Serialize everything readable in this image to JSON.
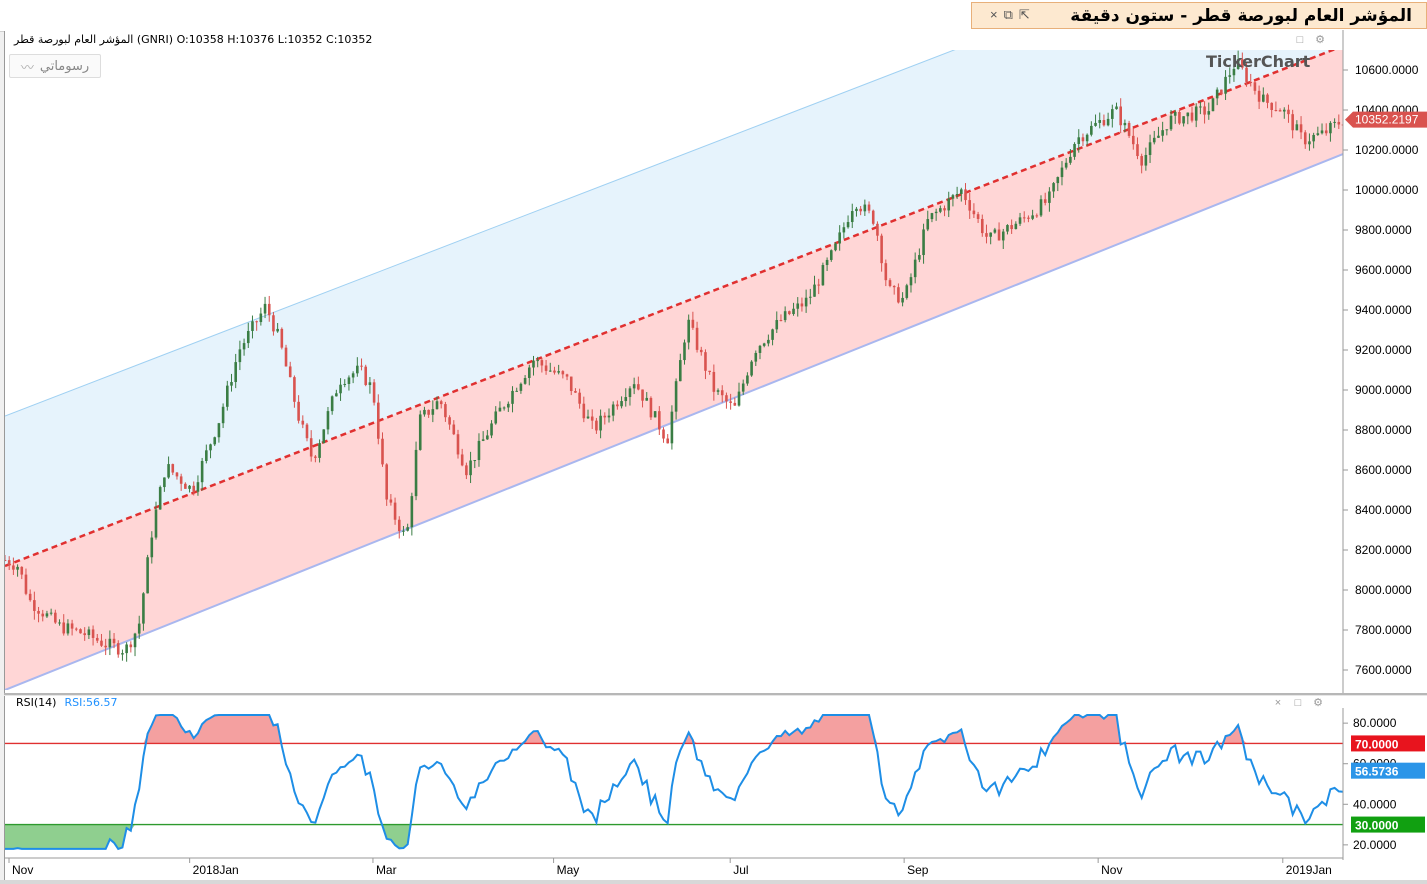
{
  "window": {
    "title": "المؤشر العام لبورصة قطر - ستون دقيقة",
    "close_glyph": "×",
    "restore_glyph": "⧉",
    "popout_glyph": "⇱"
  },
  "info_line": "المؤشر العام لبورصة قطر (GNRI)  O:10358  H:10376  L:10352  C:10352",
  "drawings_button": "رسوماتي",
  "logo": "TickerChart",
  "pane_controls": {
    "close": "×",
    "maximize": "□",
    "settings": "⚙"
  },
  "price_axis": {
    "ticks": [
      "10600.0000",
      "10400.0000",
      "10200.0000",
      "10000.0000",
      "9800.0000",
      "9600.0000",
      "9400.0000",
      "9200.0000",
      "9000.0000",
      "8800.0000",
      "8600.0000",
      "8400.0000",
      "8200.0000",
      "8000.0000",
      "7800.0000",
      "7600.0000"
    ],
    "last_price_label": "10352.2197"
  },
  "time_axis": {
    "labels": [
      "Nov",
      "2018Jan",
      "Mar",
      "May",
      "Jul",
      "Sep",
      "Nov",
      "2019Jan"
    ]
  },
  "rsi": {
    "name": "RSI(14)",
    "value_label": "RSI:56.57",
    "ticks": [
      "80.0000",
      "60.0000",
      "40.0000",
      "20.0000"
    ],
    "overbought_label": "70.0000",
    "oversold_label": "30.0000",
    "current_label": "56.5736"
  },
  "colors": {
    "up": "#3a7d44",
    "down": "#d9534f",
    "channel_upper": "#e6f3fc",
    "channel_lower": "#ffd6d6",
    "midline": "#e03030",
    "rsi_line": "#1e8ee6",
    "rsi_ob": "#e03030",
    "rsi_os": "#2e9a2e",
    "last_price": "#d9534f"
  },
  "chart_data": {
    "type": "candlestick",
    "price_ylim": [
      7500,
      10700
    ],
    "rsi_ylim": [
      15,
      85
    ],
    "rsi_levels": [
      70,
      30
    ],
    "anchors": [
      {
        "t": 0.0,
        "p": 8150
      },
      {
        "t": 0.01,
        "p": 8120
      },
      {
        "t": 0.018,
        "p": 7950
      },
      {
        "t": 0.04,
        "p": 7820
      },
      {
        "t": 0.06,
        "p": 7780
      },
      {
        "t": 0.075,
        "p": 7730
      },
      {
        "t": 0.09,
        "p": 7700
      },
      {
        "t": 0.1,
        "p": 7820
      },
      {
        "t": 0.11,
        "p": 8300
      },
      {
        "t": 0.12,
        "p": 8620
      },
      {
        "t": 0.14,
        "p": 8500
      },
      {
        "t": 0.16,
        "p": 8850
      },
      {
        "t": 0.175,
        "p": 9200
      },
      {
        "t": 0.195,
        "p": 9420
      },
      {
        "t": 0.205,
        "p": 9250
      },
      {
        "t": 0.22,
        "p": 8850
      },
      {
        "t": 0.23,
        "p": 8650
      },
      {
        "t": 0.25,
        "p": 9050
      },
      {
        "t": 0.265,
        "p": 9100
      },
      {
        "t": 0.275,
        "p": 9000
      },
      {
        "t": 0.285,
        "p": 8450
      },
      {
        "t": 0.3,
        "p": 8250
      },
      {
        "t": 0.31,
        "p": 8850
      },
      {
        "t": 0.325,
        "p": 8950
      },
      {
        "t": 0.345,
        "p": 8600
      },
      {
        "t": 0.37,
        "p": 8900
      },
      {
        "t": 0.395,
        "p": 9150
      },
      {
        "t": 0.42,
        "p": 9050
      },
      {
        "t": 0.44,
        "p": 8800
      },
      {
        "t": 0.47,
        "p": 9050
      },
      {
        "t": 0.495,
        "p": 8750
      },
      {
        "t": 0.51,
        "p": 9350
      },
      {
        "t": 0.53,
        "p": 9000
      },
      {
        "t": 0.545,
        "p": 8900
      },
      {
        "t": 0.56,
        "p": 9200
      },
      {
        "t": 0.58,
        "p": 9350
      },
      {
        "t": 0.6,
        "p": 9450
      },
      {
        "t": 0.62,
        "p": 9700
      },
      {
        "t": 0.635,
        "p": 9950
      },
      {
        "t": 0.65,
        "p": 9850
      },
      {
        "t": 0.66,
        "p": 9500
      },
      {
        "t": 0.672,
        "p": 9450
      },
      {
        "t": 0.69,
        "p": 9850
      },
      {
        "t": 0.715,
        "p": 10000
      },
      {
        "t": 0.735,
        "p": 9750
      },
      {
        "t": 0.76,
        "p": 9850
      },
      {
        "t": 0.78,
        "p": 9950
      },
      {
        "t": 0.8,
        "p": 10250
      },
      {
        "t": 0.83,
        "p": 10400
      },
      {
        "t": 0.85,
        "p": 10150
      },
      {
        "t": 0.87,
        "p": 10350
      },
      {
        "t": 0.9,
        "p": 10400
      },
      {
        "t": 0.92,
        "p": 10640
      },
      {
        "t": 0.94,
        "p": 10450
      },
      {
        "t": 0.955,
        "p": 10400
      },
      {
        "t": 0.97,
        "p": 10250
      },
      {
        "t": 0.985,
        "p": 10280
      },
      {
        "t": 1.0,
        "p": 10352
      }
    ],
    "candles": 320,
    "channel": {
      "lower_start": 7500,
      "lower_end": 10180,
      "mid_start": 8120,
      "mid_end": 10720,
      "upper_start": 8870,
      "upper_end": 11450
    }
  }
}
